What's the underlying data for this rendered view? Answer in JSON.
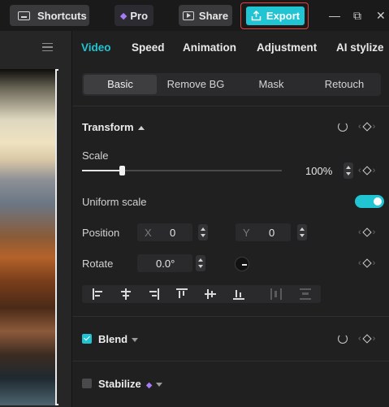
{
  "topbar": {
    "shortcuts_label": "Shortcuts",
    "pro_label": "Pro",
    "share_label": "Share",
    "export_label": "Export",
    "minimize_glyph": "—",
    "restore_glyph": "⧉",
    "close_glyph": "✕"
  },
  "panel": {
    "tabs": [
      "Video",
      "Speed",
      "Animation",
      "Adjustment",
      "AI stylize"
    ],
    "active_tab": "Video",
    "subtabs": [
      "Basic",
      "Remove BG",
      "Mask",
      "Retouch"
    ],
    "active_subtab": "Basic"
  },
  "transform": {
    "title": "Transform",
    "scale_label": "Scale",
    "scale_value": "100%",
    "scale_fraction": 0.2,
    "uniform_scale_label": "Uniform scale",
    "uniform_scale_on": true,
    "position_label": "Position",
    "x_axis": "X",
    "x_value": "0",
    "y_axis": "Y",
    "y_value": "0",
    "rotate_label": "Rotate",
    "rotate_value": "0.0°"
  },
  "blend": {
    "title": "Blend",
    "checked": true
  },
  "stabilize": {
    "title": "Stabilize",
    "checked": false
  },
  "colors": {
    "accent": "#21c4d2",
    "highlight_outline": "#e0433e",
    "pro_gem": "#a57cf5"
  }
}
